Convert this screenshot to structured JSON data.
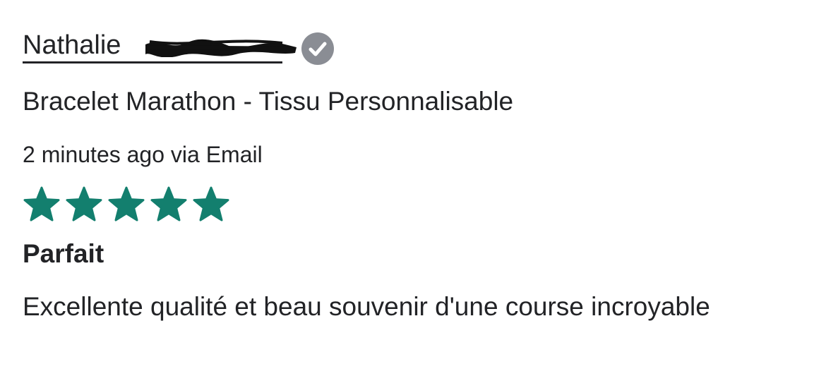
{
  "review": {
    "author_name": "Nathalie",
    "product_title": "Bracelet Marathon - Tissu Personnalisable",
    "meta": "2 minutes ago via Email",
    "rating": 5,
    "rating_max": 5,
    "review_title": "Parfait",
    "review_body": "Excellente qualité et beau souvenir d'une course incroyable"
  },
  "icons": {
    "verified": "verified-check-icon",
    "star": "star-icon",
    "redaction": "redaction-scribble"
  },
  "colors": {
    "text": "#222326",
    "star": "#137f6e",
    "verified_badge": "#8a8d94",
    "redaction": "#111111"
  }
}
